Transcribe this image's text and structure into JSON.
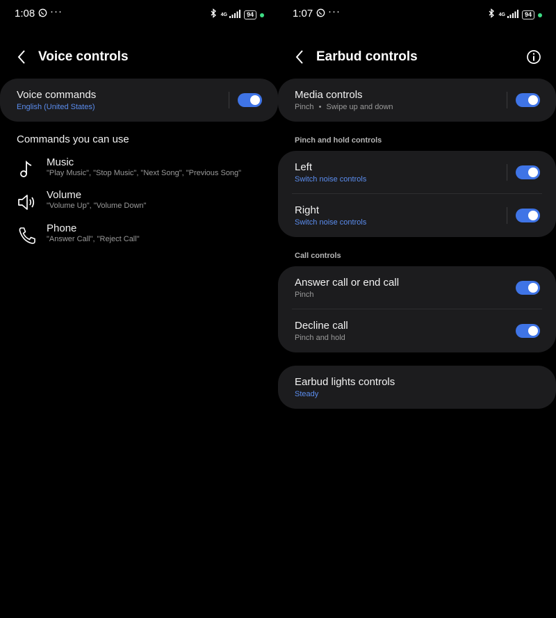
{
  "colors": {
    "background": "#000000",
    "card": "#1c1c1e",
    "accent_toggle": "#3f74e6",
    "link_blue": "#5b8def",
    "status_dot": "#3ddc84"
  },
  "left": {
    "status": {
      "time": "1:08",
      "network": "4G",
      "battery": "94"
    },
    "header": {
      "title": "Voice controls"
    },
    "voice_card": {
      "title": "Voice commands",
      "subtitle": "English (United States)",
      "toggle_on": true
    },
    "commands_heading": "Commands you can use",
    "commands": [
      {
        "icon": "music-note-icon",
        "title": "Music",
        "examples": "\"Play Music\", \"Stop Music\", \"Next Song\", \"Previous Song\""
      },
      {
        "icon": "speaker-icon",
        "title": "Volume",
        "examples": "\"Volume Up\", \"Volume Down\""
      },
      {
        "icon": "phone-icon",
        "title": "Phone",
        "examples": "\"Answer Call\", \"Reject Call\""
      }
    ]
  },
  "right": {
    "status": {
      "time": "1:07",
      "network": "4G",
      "battery": "94"
    },
    "header": {
      "title": "Earbud controls"
    },
    "media_card": {
      "title": "Media controls",
      "subtitle_a": "Pinch",
      "subtitle_sep": "•",
      "subtitle_b": "Swipe up and down",
      "toggle_on": true
    },
    "pinch_section": {
      "title": "Pinch and hold controls",
      "rows": [
        {
          "title": "Left",
          "subtitle": "Switch noise controls",
          "toggle_on": true
        },
        {
          "title": "Right",
          "subtitle": "Switch noise controls",
          "toggle_on": true
        }
      ]
    },
    "call_section": {
      "title": "Call controls",
      "rows": [
        {
          "title": "Answer call or end call",
          "subtitle": "Pinch",
          "toggle_on": true
        },
        {
          "title": "Decline call",
          "subtitle": "Pinch and hold",
          "toggle_on": true
        }
      ]
    },
    "lights_card": {
      "title": "Earbud lights controls",
      "subtitle": "Steady"
    }
  }
}
